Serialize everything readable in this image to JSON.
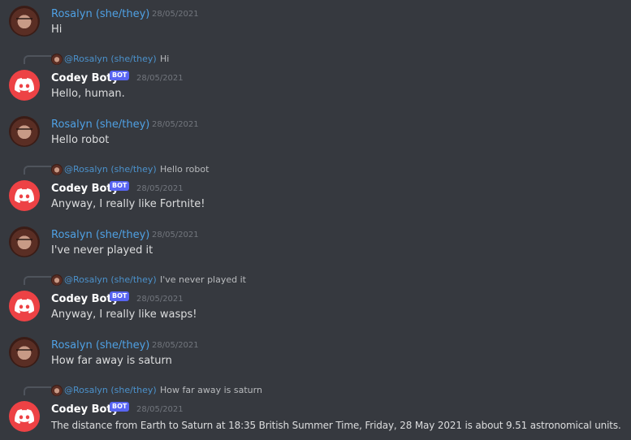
{
  "colors": {
    "background": "#36393f",
    "user_name": "#4fa1e4",
    "bot_name": "#ffffff",
    "bot_tag": "#5865f2",
    "bot_avatar": "#ed4245",
    "timestamp": "#72767d",
    "message_text": "#dcddde"
  },
  "icons": {
    "user_avatar": "user-avatar-photo",
    "bot_avatar": "discord-logo-icon",
    "reply": "reply-connector"
  },
  "messages": [
    {
      "author": "Rosalyn (she/they)",
      "timestamp": "28/05/2021",
      "text": "Hi"
    },
    {
      "reply_author": "@Rosalyn (she/they)",
      "reply_text": "Hi",
      "author": "Codey Boty",
      "bot_tag": "BOT",
      "timestamp": "28/05/2021",
      "text": "Hello, human."
    },
    {
      "author": "Rosalyn (she/they)",
      "timestamp": "28/05/2021",
      "text": "Hello robot"
    },
    {
      "reply_author": "@Rosalyn (she/they)",
      "reply_text": "Hello robot",
      "author": "Codey Boty",
      "bot_tag": "BOT",
      "timestamp": "28/05/2021",
      "text": "Anyway, I really like Fortnite!"
    },
    {
      "author": "Rosalyn (she/they)",
      "timestamp": "28/05/2021",
      "text": "I've never played it"
    },
    {
      "reply_author": "@Rosalyn (she/they)",
      "reply_text": "I've never played it",
      "author": "Codey Boty",
      "bot_tag": "BOT",
      "timestamp": "28/05/2021",
      "text": "Anyway, I really like wasps!"
    },
    {
      "author": "Rosalyn (she/they)",
      "timestamp": "28/05/2021",
      "text": "How far away is saturn"
    },
    {
      "reply_author": "@Rosalyn (she/they)",
      "reply_text": "How far away is saturn",
      "author": "Codey Boty",
      "bot_tag": "BOT",
      "timestamp": "28/05/2021",
      "text": "The distance from Earth to Saturn at 18:35 British Summer Time, Friday, 28 May 2021 is about 9.51 astronomical units."
    }
  ]
}
